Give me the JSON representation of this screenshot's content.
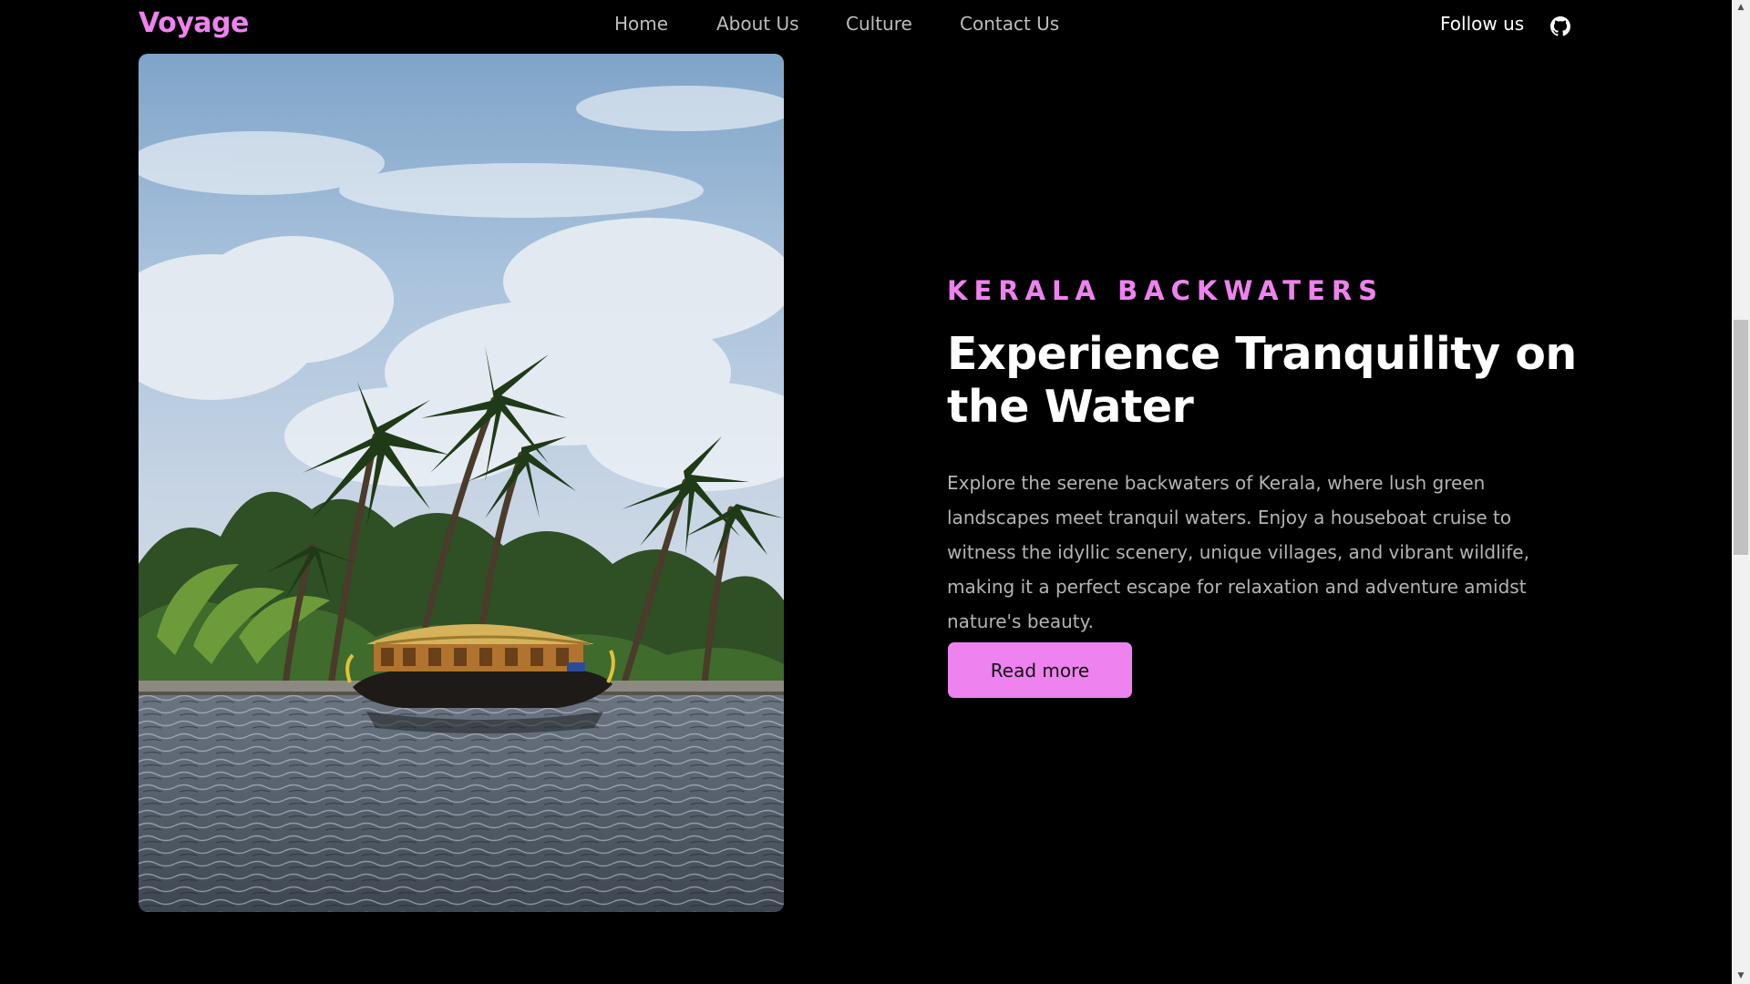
{
  "nav": {
    "logo": "Voyage",
    "links": [
      "Home",
      "About Us",
      "Culture",
      "Contact Us"
    ],
    "follow_label": "Follow us",
    "social_icon": "github-icon"
  },
  "hero": {
    "image_icon": "kerala-backwaters-photo",
    "eyebrow": "KERALA BACKWATERS",
    "title": "Experience Tranquility on the Water",
    "description": "Explore the serene backwaters of Kerala, where lush green landscapes meet tranquil waters. Enjoy a houseboat cruise to witness the idyllic scenery, unique villages, and vibrant wildlife, making it a perfect escape for relaxation and adventure amidst nature's beauty.",
    "cta_label": "Read more"
  },
  "colors": {
    "background": "#000000",
    "accent": "#ee82ee",
    "text_primary": "#ffffff",
    "text_muted": "#b4b4b4",
    "nav_link": "#bdbdbd"
  }
}
